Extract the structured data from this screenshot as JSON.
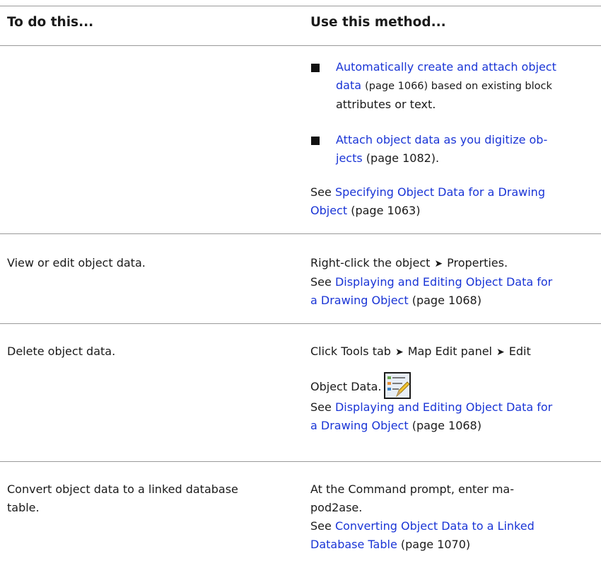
{
  "header": {
    "col1": "To do this...",
    "col2": "Use this method..."
  },
  "row1": {
    "bullet1": {
      "link_a": "Automatically create and attach object",
      "link_b": "data",
      "page_ref": "(page 1066) based on existing block",
      "rest": "attributes or text."
    },
    "bullet2": {
      "link_a": "Attach object data as you digitize ob-",
      "link_b": "jects",
      "rest": "(page 1082)."
    },
    "see_prefix": "See",
    "see_link_a": "Specifying Object Data for a Drawing",
    "see_link_b": "Object",
    "see_page": "(page 1063)"
  },
  "row2": {
    "task": "View or edit object data.",
    "method_a": "Right-click the object",
    "method_b": "Properties.",
    "see_prefix": "See",
    "see_link_a": "Displaying and Editing Object Data for",
    "see_link_b": "a Drawing Object",
    "see_page": "(page 1068)"
  },
  "row3": {
    "task": "Delete object data.",
    "method_a": "Click Tools tab",
    "method_b": "Map Edit panel",
    "method_c": "Edit",
    "method_d": "Object Data.",
    "icon": "edit-object-data-icon",
    "see_prefix": "See",
    "see_link_a": "Displaying and Editing Object Data for",
    "see_link_b": "a Drawing Object",
    "see_page": "(page 1068)"
  },
  "row4": {
    "task_a": "Convert object data to a linked database",
    "task_b": "table.",
    "method_a": "At the Command prompt, enter ma-",
    "method_b": "pod2ase.",
    "see_prefix": "See",
    "see_link_a": "Converting Object Data to a Linked",
    "see_link_b": "Database Table",
    "see_page": "(page 1070)"
  },
  "arrow_glyph": "➤",
  "colors": {
    "link": "#1a35d6",
    "rule": "#9a9a9a",
    "text": "#1a1a1a"
  }
}
